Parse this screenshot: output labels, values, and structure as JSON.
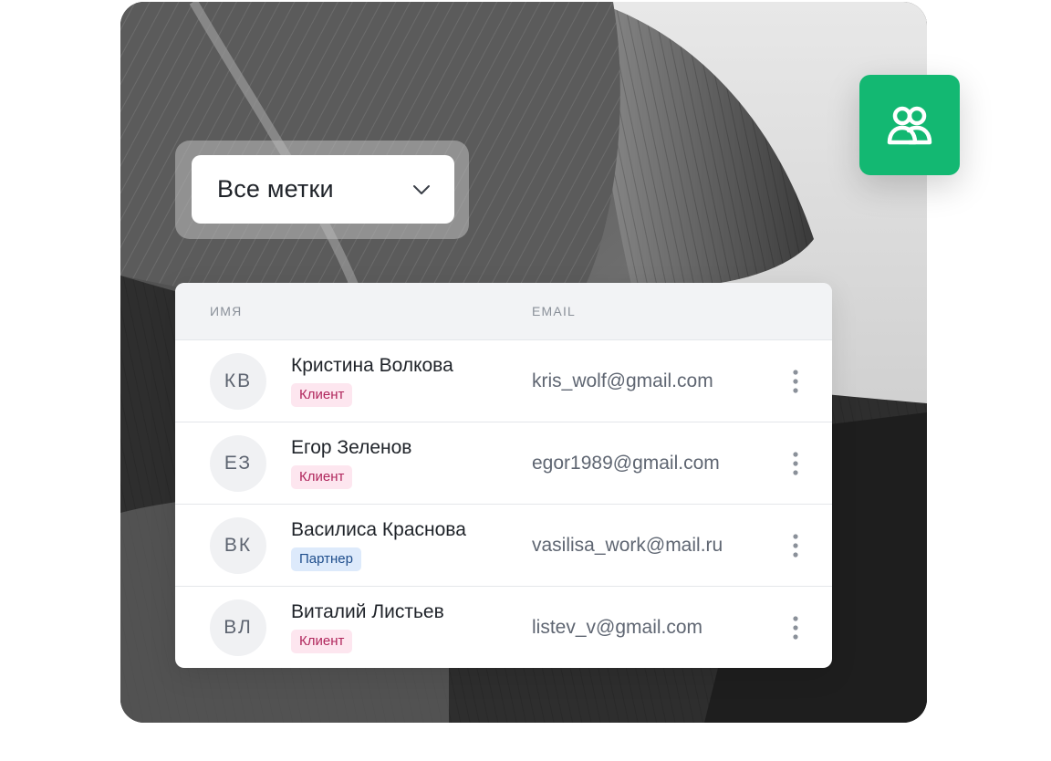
{
  "filter": {
    "label": "Все метки",
    "icon": "chevron-down-icon"
  },
  "app_badge": {
    "icon": "users-icon",
    "color": "#13b872"
  },
  "table": {
    "columns": [
      "ИМЯ",
      "EMAIL"
    ],
    "rows": [
      {
        "initials": "КВ",
        "name": "Кристина Волкова",
        "tag": "Клиент",
        "tag_type": "client",
        "email": "kris_wolf@gmail.com"
      },
      {
        "initials": "ЕЗ",
        "name": "Егор Зеленов",
        "tag": "Клиент",
        "tag_type": "client",
        "email": "egor1989@gmail.com"
      },
      {
        "initials": "ВК",
        "name": "Василиса Краснова",
        "tag": "Партнер",
        "tag_type": "partner",
        "email": "vasilisa_work@mail.ru"
      },
      {
        "initials": "ВЛ",
        "name": "Виталий Листьев",
        "tag": "Клиент",
        "tag_type": "client",
        "email": "listev_v@gmail.com"
      }
    ]
  },
  "colors": {
    "client_tag_bg": "#fde6ef",
    "client_tag_text": "#b0265c",
    "partner_tag_bg": "#ddeafb",
    "partner_tag_text": "#1f4e8c"
  }
}
